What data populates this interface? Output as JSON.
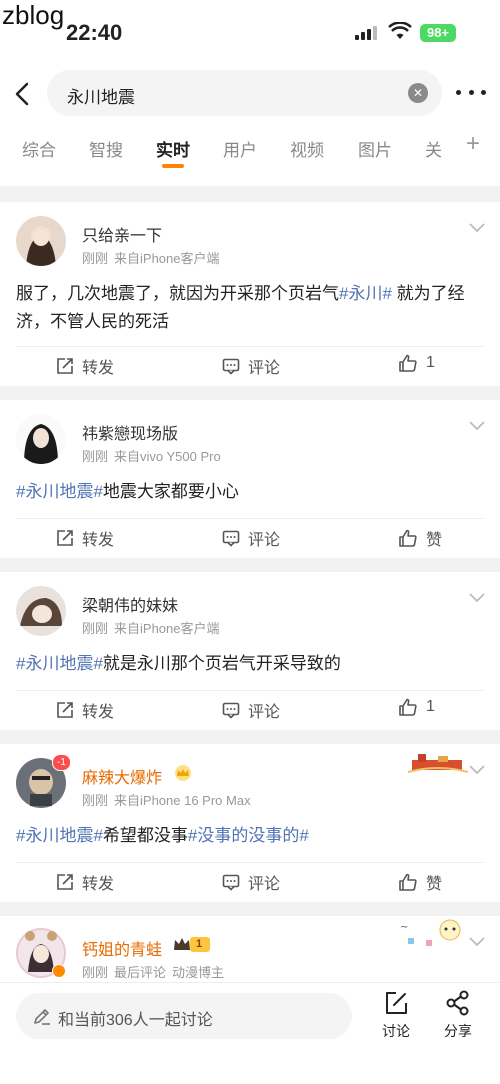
{
  "watermark": "zblog",
  "status": {
    "time": "22:40",
    "battery": "98+"
  },
  "search": {
    "query": "永川地震",
    "clear_icon": "close-circle-icon",
    "more_icon": "more-dots-icon"
  },
  "tabs": [
    {
      "label": "综合"
    },
    {
      "label": "智搜"
    },
    {
      "label": "实时",
      "active": true
    },
    {
      "label": "用户"
    },
    {
      "label": "视频"
    },
    {
      "label": "图片"
    },
    {
      "label": "关"
    }
  ],
  "tab_plus": "+",
  "posts": [
    {
      "username": "只给亲一下",
      "time": "刚刚",
      "source": "来自iPhone客户端",
      "text_before": "服了，几次地震了，就因为开采那个页岩气",
      "topic": "#永川#",
      "text_after": " 就为了经济，不管人民的死活",
      "repost": "转发",
      "comment": "评论",
      "like": "1"
    },
    {
      "username": "祎紫戀现场版",
      "time": "刚刚",
      "source": "来自vivo Y500 Pro",
      "topic": "#永川地震#",
      "text_after": "地震大家都要小心",
      "repost": "转发",
      "comment": "评论",
      "like": "赞"
    },
    {
      "username": "梁朝伟的妹妹",
      "time": "刚刚",
      "source": "来自iPhone客户端",
      "topic": "#永川地震#",
      "text_after": "就是永川那个页岩气开采导致的",
      "repost": "转发",
      "comment": "评论",
      "like": "1"
    },
    {
      "username": "麻辣大爆炸",
      "time": "刚刚",
      "source": "来自iPhone 16 Pro Max",
      "topic": "#永川地震#",
      "text_mid": "希望都没事",
      "topic2": "#没事的没事的#",
      "repost": "转发",
      "comment": "评论",
      "like": "赞",
      "avatar_badge": "-1"
    },
    {
      "username": "钙姐的青蛙",
      "time": "刚刚",
      "source": "最后评论",
      "tag": "动漫博主",
      "level": "1"
    }
  ],
  "bottom": {
    "discuss_placeholder": "和当前306人一起讨论",
    "comment_label": "讨论",
    "share_label": "分享"
  }
}
